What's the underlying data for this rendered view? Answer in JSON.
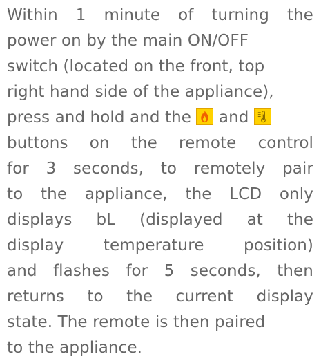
{
  "lines": [
    [
      "Within",
      "1",
      "minute",
      "of",
      "turning",
      "the"
    ],
    [
      "power on by the main ON/OFF"
    ],
    [
      "switch (located on the front, top"
    ],
    [
      "right hand side of the appliance),"
    ],
    [
      "press and hold and the",
      "and"
    ],
    [
      "buttons",
      "on",
      "the",
      "remote",
      "control"
    ],
    [
      "for",
      "3",
      "seconds,",
      "to",
      "remotely",
      "pair"
    ],
    [
      "to",
      "the",
      "appliance,",
      "the",
      "LCD",
      "only"
    ],
    [
      "displays",
      "bL",
      "(displayed",
      "at",
      "the"
    ],
    [
      "display",
      "temperature",
      "position)"
    ],
    [
      "and",
      "flashes",
      "for",
      "5",
      "seconds,",
      "then"
    ],
    [
      "returns",
      "to",
      "the",
      "current",
      "display"
    ],
    [
      "state. The remote is then paired"
    ],
    [
      "to the appliance."
    ]
  ],
  "icons": {
    "flame": "flame-icon",
    "thermometer": "thermometer-icon"
  },
  "colors": {
    "text": "#666666",
    "icon_bg": "#ffd200",
    "flame": "#f06000"
  }
}
